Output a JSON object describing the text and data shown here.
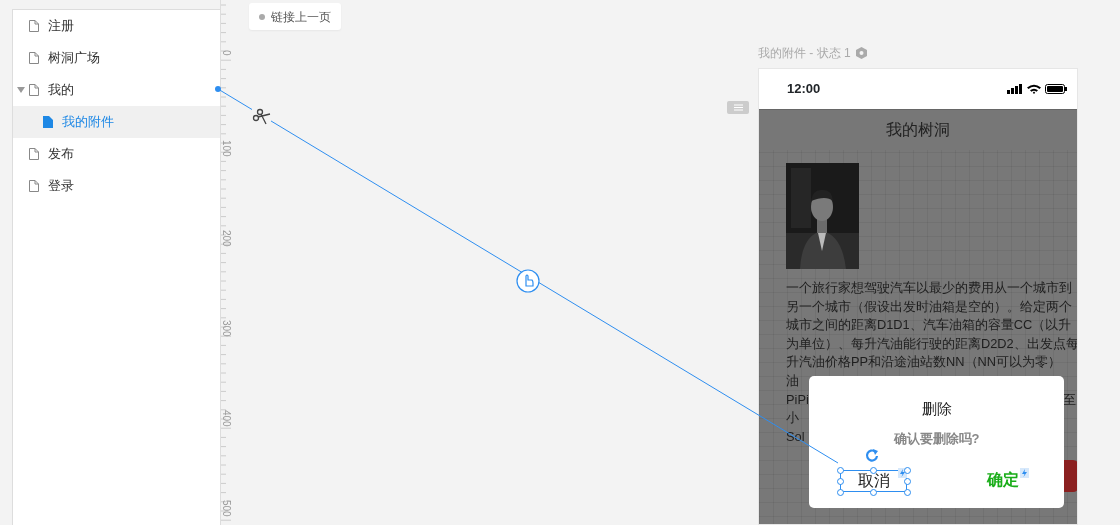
{
  "sidebar": {
    "items": [
      {
        "label": "注册",
        "selected": false,
        "expanded": false
      },
      {
        "label": "树洞广场",
        "selected": false,
        "expanded": false
      },
      {
        "label": "我的",
        "selected": false,
        "expanded": true,
        "children": [
          {
            "label": "我的附件",
            "selected": true,
            "expanded": false
          }
        ]
      },
      {
        "label": "发布",
        "selected": false,
        "expanded": false
      },
      {
        "label": "登录",
        "selected": false,
        "expanded": false
      }
    ]
  },
  "ruler": {
    "labels": [
      "0",
      "100",
      "200",
      "300",
      "400",
      "500"
    ]
  },
  "link_action": {
    "label": "链接上一页"
  },
  "artboard": {
    "title": "我的附件 - 状态 1",
    "status_bar": {
      "time": "12:00"
    },
    "nav_title": "我的树洞",
    "paragraph_lines": [
      {
        "left": "一个旅行家想驾驶汽车以最少的费用从一个城市到"
      },
      {
        "left": "另一个城市（假设出发时油箱是空的）。给定两个"
      },
      {
        "left": "城市之间的距离D1D1、汽车油箱的容量CC（以升"
      },
      {
        "left": "为单位）、每升汽油能行驶的距离D2D2、出发点每"
      },
      {
        "left": "升汽油价格PP和沿途油站数NN（NN可以为零）"
      },
      {
        "left": "油"
      },
      {
        "left": "PiPi",
        "right": "至"
      },
      {
        "left": "小"
      },
      {
        "left": "Sol"
      }
    ],
    "dialog": {
      "title": "删除",
      "message": "确认要删除吗?",
      "buttons": [
        {
          "label": "取消",
          "kind": "cancel",
          "selected": true
        },
        {
          "label": "确定",
          "kind": "confirm",
          "selected": false
        }
      ]
    }
  }
}
